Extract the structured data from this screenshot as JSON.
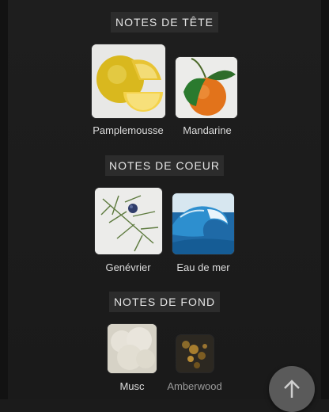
{
  "sections": [
    {
      "title": "NOTES DE TÊTE",
      "notes": [
        {
          "label": "Pamplemousse",
          "icon": "grapefruit-image"
        },
        {
          "label": "Mandarine",
          "icon": "mandarin-image"
        }
      ]
    },
    {
      "title": "NOTES DE COEUR",
      "notes": [
        {
          "label": "Genévrier",
          "icon": "juniper-image"
        },
        {
          "label": "Eau de mer",
          "icon": "sea-wave-image"
        }
      ]
    },
    {
      "title": "NOTES DE FOND",
      "notes": [
        {
          "label": "Musc",
          "icon": "musk-image"
        },
        {
          "label": "Amberwood",
          "icon": "amberwood-image"
        }
      ]
    }
  ],
  "scroll_top_button": {
    "icon": "arrow-up-icon"
  }
}
